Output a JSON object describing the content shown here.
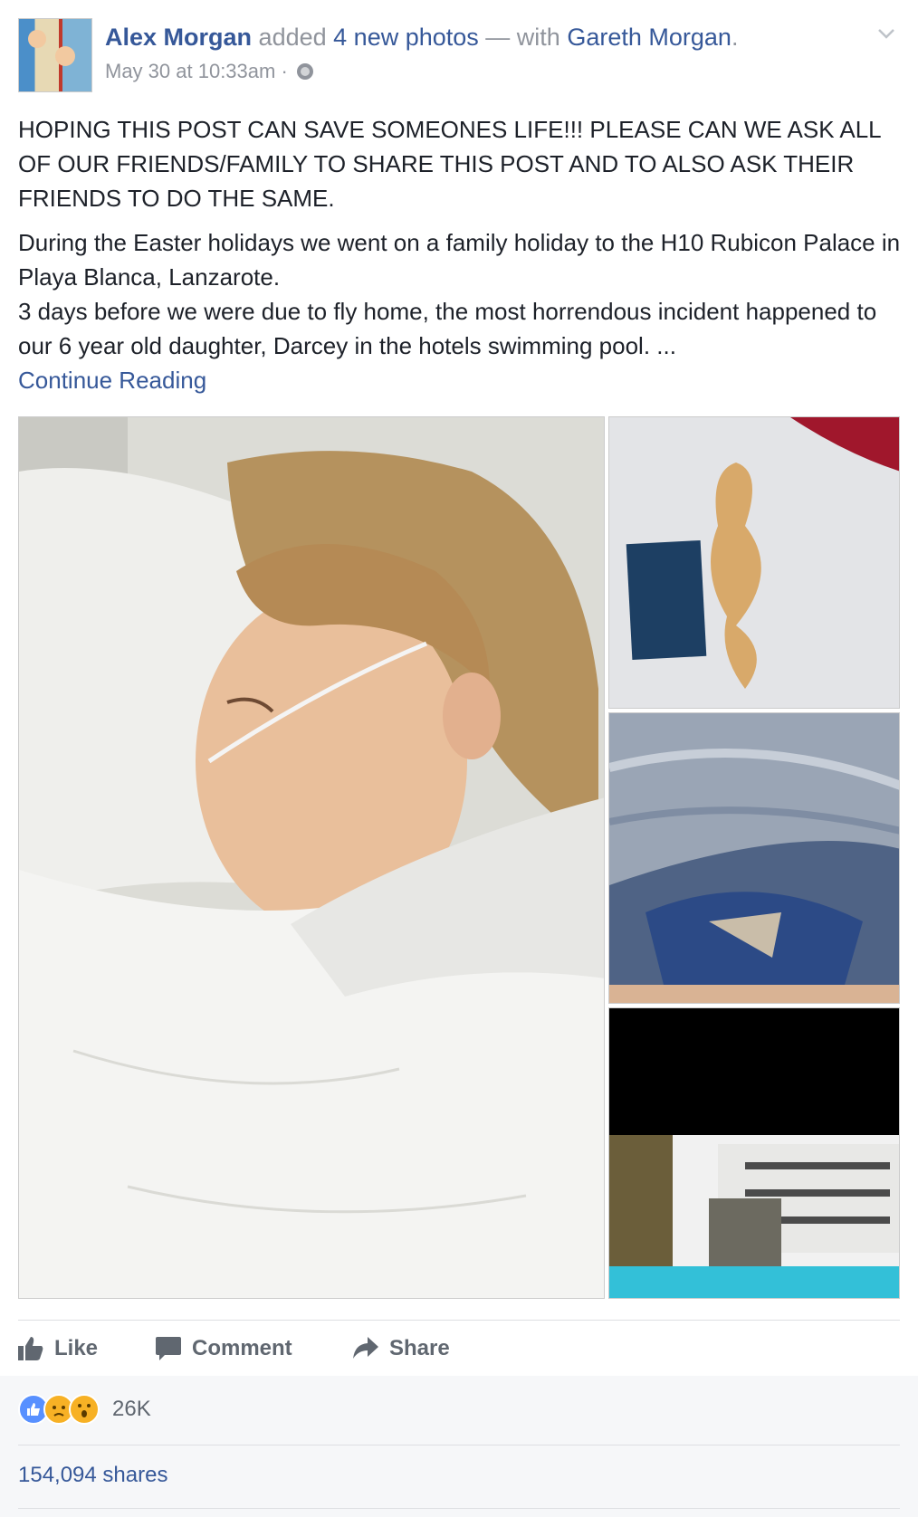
{
  "post": {
    "author": "Alex Morgan",
    "action_text": "added",
    "photos_link": "4 new photos",
    "with_text": "— with",
    "tagged": "Gareth Morgan",
    "period": ".",
    "timestamp": "May 30 at 10:33am",
    "separator": "·",
    "privacy_icon": "globe-icon",
    "paragraph_1": "HOPING THIS POST CAN SAVE SOMEONES LIFE!!! PLEASE CAN WE ASK ALL OF OUR FRIENDS/FAMILY TO SHARE THIS POST AND TO ALSO ASK THEIR FRIENDS TO DO THE SAME.",
    "paragraph_2": "During the Easter holidays we went on a family holiday to the H10 Rubicon Palace in Playa Blanca, Lanzarote.",
    "paragraph_3": "3 days before we were due to fly home, the most horrendous incident happened to our 6 year old daughter, Darcey in the hotels swimming pool. ...",
    "continue_link": "Continue Reading"
  },
  "actions": {
    "like": "Like",
    "comment": "Comment",
    "share": "Share"
  },
  "stats": {
    "reaction_count": "26K",
    "reactions": [
      "like",
      "sad",
      "wow"
    ],
    "shares": "154,094 shares"
  },
  "colors": {
    "link": "#365899",
    "meta": "#90949c",
    "action": "#606770",
    "like_blue": "#5890ff",
    "emoji_yellow": "#f7b125"
  }
}
